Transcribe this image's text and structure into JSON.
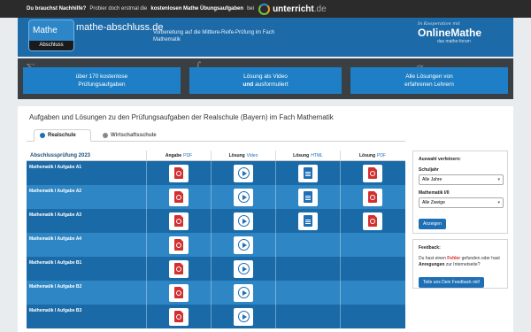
{
  "topbar": {
    "question": "Du brauchst Nachhilfe?",
    "text1": "Probier doch erstmal die",
    "highlight": "kostenlosen Mathe Übungsaufgaben",
    "text2": "bei",
    "brand": "unterricht",
    "brand_tld": ".de"
  },
  "header": {
    "badge_top": "Mathe",
    "badge_bottom": "Abschluss",
    "domain": "mathe-abschluss.de",
    "subtitle": "Vorbereitung auf die Mittlere-Reife-Prüfung im Fach Mathematik",
    "koop_label": "In Kooperation mit",
    "partner": "OnlineMathe",
    "partner_sub": "das mathe-forum"
  },
  "hero": {
    "btn1_line1": "über 170 kostenlose",
    "btn1_line2": "Prüfungsaufgaben",
    "btn2_line1": "Lösung als Video",
    "btn2_line2_a": "und",
    "btn2_line2_b": "ausformuliert",
    "btn3_line1": "Alle Lösungen von",
    "btn3_line2": "erfahrenen Lehrern"
  },
  "content": {
    "title": "Aufgaben und Lösungen zu den Prüfungsaufgaben der Realschule (Bayern) im Fach Mathematik",
    "tabs": [
      "Realschule",
      "Wirtschaftsschule"
    ]
  },
  "table": {
    "header": {
      "year": "Abschlussprüfung 2023",
      "cols": [
        {
          "label": "Angabe",
          "fmt": "PDF"
        },
        {
          "label": "Lösung",
          "fmt": "Video"
        },
        {
          "label": "Lösung",
          "fmt": "HTML"
        },
        {
          "label": "Lösung",
          "fmt": "PDF"
        }
      ]
    },
    "rows": [
      {
        "label": "Mathematik I Aufgabe A1",
        "icons": [
          "pdf-icon",
          "play-icon",
          "html-icon",
          "pdf-icon"
        ]
      },
      {
        "label": "Mathematik I Aufgabe A2",
        "icons": [
          "pdf-icon",
          "play-icon",
          "html-icon",
          "pdf-icon"
        ]
      },
      {
        "label": "Mathematik I Aufgabe A3",
        "icons": [
          "pdf-icon",
          "play-icon",
          "html-icon",
          "pdf-icon"
        ]
      },
      {
        "label": "Mathematik I Aufgabe A4",
        "icons": [
          "pdf-icon",
          "play-icon"
        ]
      },
      {
        "label": "Mathematik I Aufgabe B1",
        "icons": [
          "pdf-icon",
          "play-icon"
        ]
      },
      {
        "label": "Mathematik I Aufgabe B2",
        "icons": [
          "pdf-icon",
          "play-icon"
        ]
      },
      {
        "label": "Mathematik I Aufgabe B3",
        "icons": [
          "pdf-icon",
          "play-icon"
        ]
      }
    ]
  },
  "filter": {
    "title": "Auswahl verfeinern:",
    "label1": "Schuljahr",
    "value1": "Alle Jahre",
    "label2": "Mathematik I/II",
    "value2": "Alle Zweige",
    "button": "Anzeigen"
  },
  "feedback": {
    "title": "Feedback:",
    "t1": "Du hast einen",
    "t2": "Fehler",
    "t3": "gefunden oder hast",
    "t4": "Anregungen",
    "t5": "zur Internetseite?",
    "button": "Teile uns Dein Feedback mit!"
  },
  "colors": {
    "primary": "#1e6fb5",
    "row_dark": "#1b6aa8",
    "row_light": "#2e86c4",
    "pdf_red": "#d32f2f"
  }
}
